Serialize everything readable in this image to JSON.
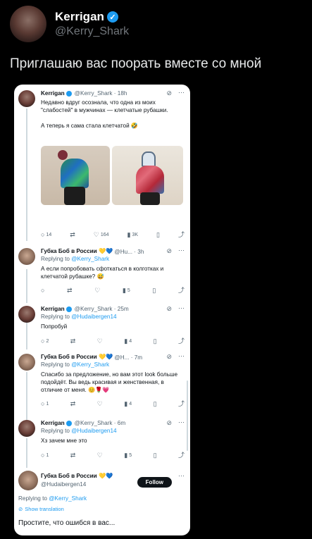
{
  "post": {
    "author_name": "Kerrigan",
    "author_handle": "@Kerry_Shark",
    "text": "Приглашаю вас поорать вместе со мной"
  },
  "colors": {
    "accent": "#1d9bf0",
    "dark_bg": "#000000",
    "card_bg": "#ffffff"
  },
  "thread": {
    "t1": {
      "name": "Kerrigan",
      "meta": "@Kerry_Shark · 18h",
      "text": "Недавно вдруг осознала, что одна из моих \"слабостей\" в мужчинах — клетчатые рубашки.\n\nА теперь я сама стала клетчатой 🤣",
      "stats": {
        "replies": "14",
        "likes": "164",
        "views": "3K"
      }
    },
    "t2": {
      "name": "Губка Боб в России 💛💙",
      "meta": "@Hu... · 3h",
      "reply_prefix": "Replying to",
      "reply_handle": "@Kerry_Shark",
      "text": "А если попробовать сфоткаться в колготках и клетчатой рубашке? 😅",
      "stats": {
        "views": "5"
      }
    },
    "t3": {
      "name": "Kerrigan",
      "meta": "@Kerry_Shark · 25m",
      "reply_prefix": "Replying to",
      "reply_handle": "@Hudaibergen14",
      "text": "Попробуй",
      "stats": {
        "replies": "2",
        "views": "4"
      }
    },
    "t4": {
      "name": "Губка Боб в России 💛💙",
      "meta": "@H... · 7m",
      "reply_prefix": "Replying to",
      "reply_handle": "@Kerry_Shark",
      "text": "Спасибо за предложение, но вам этот look больше подойдёт. Вы ведь красивая и женственная, в отличие от меня. 😊🌹💗",
      "stats": {
        "replies": "1",
        "views": "4"
      }
    },
    "t5": {
      "name": "Kerrigan",
      "meta": "@Kerry_Shark · 6m",
      "reply_prefix": "Replying to",
      "reply_handle": "@Hudaibergen14",
      "text": "Хз зачем мне это",
      "stats": {
        "replies": "1",
        "views": "5"
      }
    },
    "t6": {
      "name": "Губка Боб в России 💛💙",
      "handle": "@Hudaibergen14",
      "follow_label": "Follow",
      "reply_prefix": "Replying to",
      "reply_handle": "@Kerry_Shark",
      "show_translation": "Show translation",
      "text": "Простите, что ошибся в вас..."
    }
  }
}
